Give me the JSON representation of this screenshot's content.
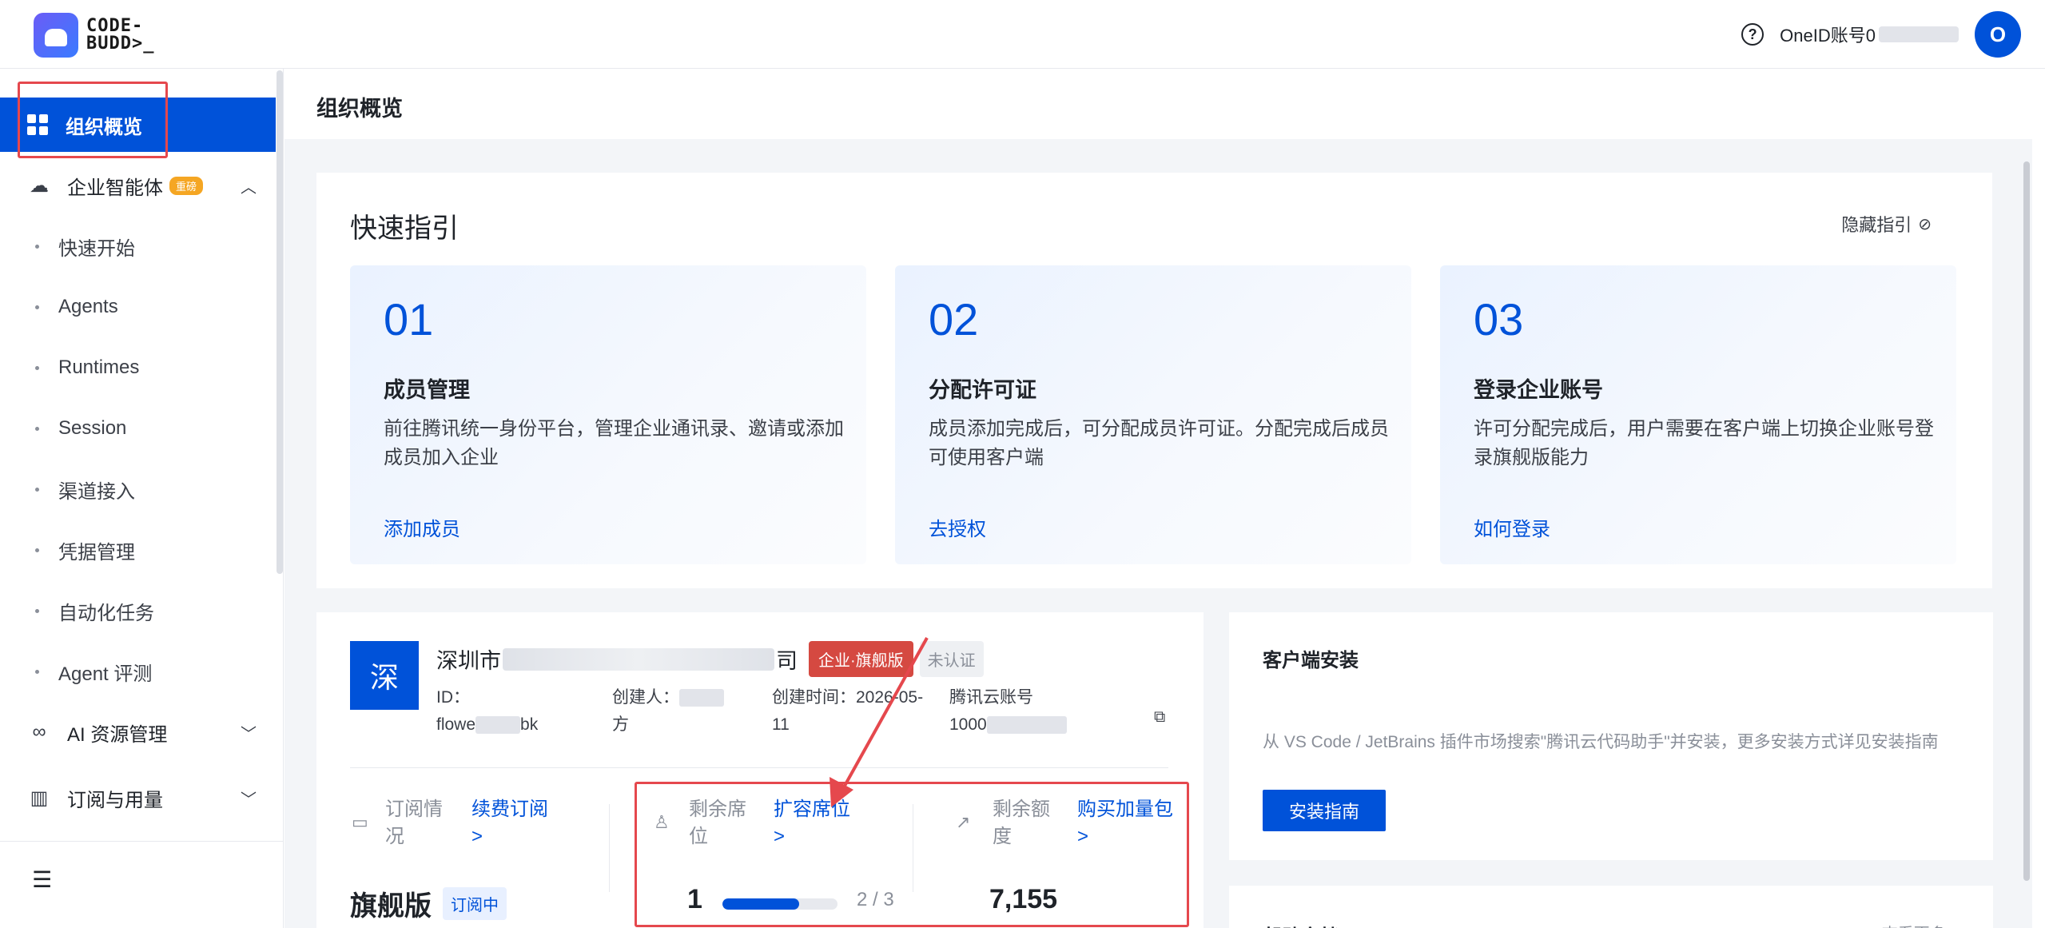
{
  "app": {
    "logo_text_line1": "CODE-",
    "logo_text_line2": "BUDD>_",
    "account_label": "OneID账号0",
    "avatar_letter": "O",
    "help_glyph": "?"
  },
  "sidebar": {
    "active_item": "组织概览",
    "groups": [
      {
        "label": "企业智能体",
        "badge": "重磅",
        "expanded": true
      },
      {
        "label": "AI 资源管理",
        "expanded": false
      },
      {
        "label": "订阅与用量",
        "expanded": false
      }
    ],
    "subitems": [
      "快速开始",
      "Agents",
      "Runtimes",
      "Session",
      "渠道接入",
      "凭据管理",
      "自动化任务",
      "Agent 评测"
    ]
  },
  "page": {
    "title": "组织概览"
  },
  "guide": {
    "title": "快速指引",
    "hide_label": "隐藏指引",
    "steps": [
      {
        "num": "01",
        "title": "成员管理",
        "desc": "前往腾讯统一身份平台，管理企业通讯录、邀请或添加成员加入企业",
        "link": "添加成员"
      },
      {
        "num": "02",
        "title": "分配许可证",
        "desc": "成员添加完成后，可分配成员许可证。分配完成后成员可使用客户端",
        "link": "去授权"
      },
      {
        "num": "03",
        "title": "登录企业账号",
        "desc": "许可分配完成后，用户需要在客户端上切换企业账号登录旗舰版能力",
        "link": "如何登录"
      }
    ]
  },
  "org": {
    "logo_char": "深",
    "name_prefix": "深圳市",
    "name_suffix": "司",
    "edition_tag": "企业·旗舰版",
    "verify_tag": "未认证",
    "id_label": "ID：",
    "id_value_prefix": "flowe",
    "id_value_suffix": "bk",
    "creator_label": "创建人：",
    "creator_value": "方",
    "created_label": "创建时间：2026-05-",
    "created_value": "11",
    "cloud_label": "腾讯云账号",
    "cloud_value": "1000"
  },
  "stats": {
    "subscription": {
      "label_line1": "订阅情",
      "label_line2": "况",
      "link_line1": "续费订阅",
      "link_line2": ">",
      "plan": "旗舰版",
      "status": "订阅中"
    },
    "seats": {
      "label_line1": "剩余席",
      "label_line2": "位",
      "link_line1": "扩容席位",
      "link_line2": ">",
      "remaining": "1",
      "used_total": "2 / 3",
      "progress": 0.67
    },
    "quota": {
      "label_line1": "剩余额",
      "label_line2": "度",
      "link_line1": "购买加量包",
      "link_line2": ">",
      "value": "7,155"
    }
  },
  "client": {
    "title": "客户端安装",
    "desc": "从 VS Code / JetBrains 插件市场搜索\"腾讯云代码助手\"并安装，更多安装方式详见安装指南",
    "button": "安装指南"
  },
  "docs": {
    "title": "帮助文档",
    "more": "查看更多 >"
  },
  "colors": {
    "brand": "#0052d9",
    "highlight": "#e5484d",
    "edition_tag": "#d54941"
  }
}
